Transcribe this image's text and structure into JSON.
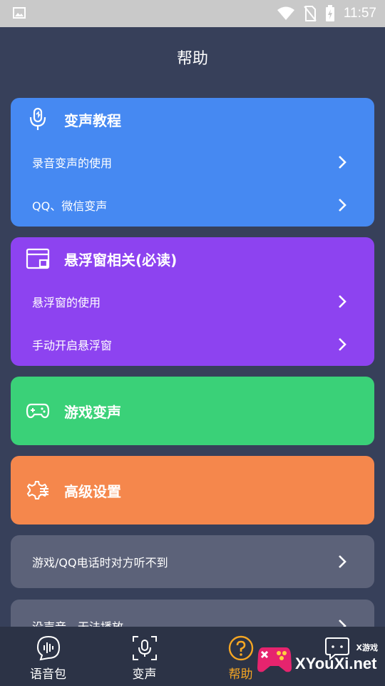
{
  "status_bar": {
    "time": "11:57"
  },
  "header": {
    "title": "帮助"
  },
  "cards": {
    "voice_tutorial": {
      "title": "变声教程",
      "items": [
        "录音变声的使用",
        "QQ、微信变声"
      ]
    },
    "floating_window": {
      "title": "悬浮窗相关(必读)",
      "items": [
        "悬浮窗的使用",
        "手动开启悬浮窗"
      ]
    },
    "game_voice": {
      "title": "游戏变声"
    },
    "advanced_settings": {
      "title": "高级设置"
    },
    "faq": {
      "items": [
        "游戏/QQ电话时对方听不到",
        "没声音，无法播放"
      ]
    }
  },
  "tabs": [
    {
      "label": "语音包",
      "icon": "voice-pack-icon"
    },
    {
      "label": "变声",
      "icon": "voice-change-icon"
    },
    {
      "label": "帮助",
      "icon": "help-icon",
      "active": true
    },
    {
      "label": "",
      "icon": "message-icon"
    }
  ],
  "watermark": {
    "text": "XYouXi.net",
    "small": "X游戏"
  },
  "colors": {
    "background": "#37405a",
    "blue": "#4689f2",
    "purple": "#8d43f0",
    "green": "#3ad178",
    "orange": "#f5874c",
    "gray": "#5c6279",
    "tab_active": "#f5a623"
  }
}
